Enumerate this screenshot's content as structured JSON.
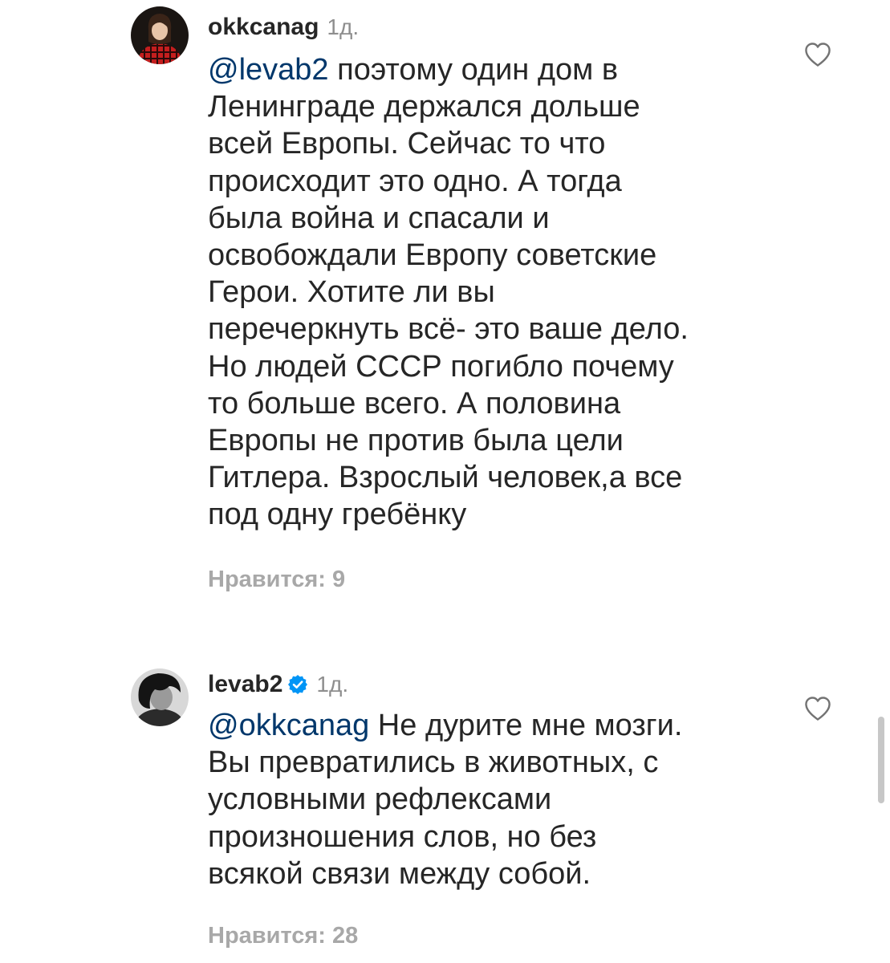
{
  "comments": [
    {
      "username": "okkcanag",
      "time": "1д.",
      "mention": "@levab2",
      "text": " поэтому один дом в\nЛенинграде держался дольше\nвсей Европы. Сейчас то что\nпроисходит это одно. А тогда\nбыла война и спасали и\nосвобождали Европу советские\nГерои. Хотите ли вы\nперечеркнуть всё- это ваше дело.\nНо людей СССР погибло почему\nто больше всего. А половина\nЕвропы не против была цели\nГитлера. Взрослый человек,а все\nпод одну гребёнку",
      "likes": "Нравится: 9",
      "verified": false,
      "avatar_icon": "user-avatar-red-plaid",
      "like_icon": "heart-outline-icon"
    },
    {
      "username": "levab2",
      "time": "1д.",
      "mention": "@okkcanag",
      "text": " Не дурите мне мозги.\nВы превратились в животных, с\nусловными рефлексами\nпроизношения слов, но без\nвсякой связи между собой.",
      "likes": "Нравится: 28",
      "verified": true,
      "avatar_icon": "user-avatar-grayscale",
      "like_icon": "heart-outline-icon"
    }
  ],
  "colors": {
    "text": "#262626",
    "mention": "#00376b",
    "secondary": "#8e8e8e",
    "likes": "#a8a8a8",
    "verified": "#0095f6"
  }
}
